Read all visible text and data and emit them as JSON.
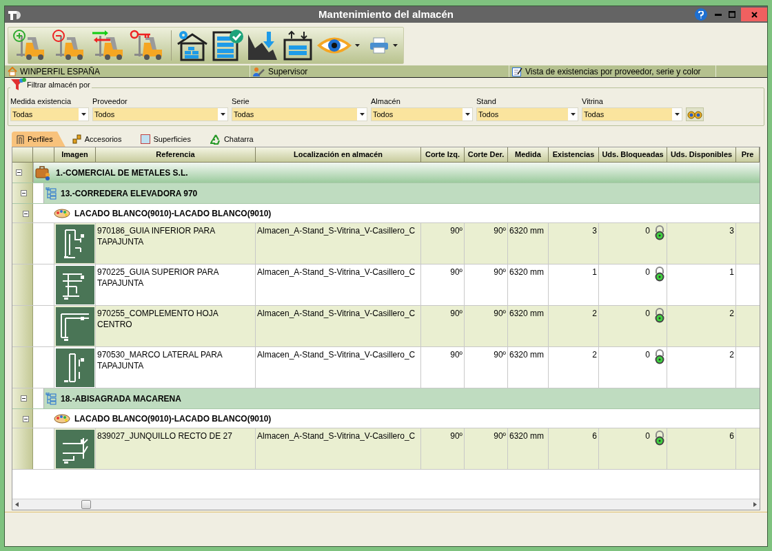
{
  "window": {
    "title": "Mantenimiento del almacén"
  },
  "status_bar": [
    "WINPERFIL ESPAÑA",
    "Supervisor",
    "Vista de existencias por proveedor, serie y color"
  ],
  "filter": {
    "title": "Filtrar almacén por",
    "fields": [
      {
        "label": "Medida existencia",
        "value": "Todas"
      },
      {
        "label": "Proveedor",
        "value": "Todos"
      },
      {
        "label": "Serie",
        "value": "Todas"
      },
      {
        "label": "Almacén",
        "value": "Todos"
      },
      {
        "label": "Stand",
        "value": "Todos"
      },
      {
        "label": "Vitrina",
        "value": "Todas"
      }
    ]
  },
  "tabs": [
    {
      "label": "Perfiles",
      "selected": true
    },
    {
      "label": "Accesorios",
      "selected": false
    },
    {
      "label": "Superficies",
      "selected": false
    },
    {
      "label": "Chatarra",
      "selected": false
    }
  ],
  "table": {
    "columns": [
      "Imagen",
      "Referencia",
      "Localización en almacén",
      "Corte Izq.",
      "Corte Der.",
      "Medida",
      "Existencias",
      "Uds. Bloqueadas",
      "Uds. Disponibles",
      "Pre"
    ],
    "suppliers": [
      {
        "name": "1.-COMERCIAL DE METALES S.L.",
        "expanded": true,
        "series": [
          {
            "name": "13.-CORREDERA ELEVADORA 970",
            "expanded": true,
            "colors": [
              {
                "name": "LACADO BLANCO(9010)-LACADO BLANCO(9010)",
                "expanded": true,
                "rows": [
                  {
                    "reference": "970186_GUIA INFERIOR PARA TAPAJUNTA",
                    "location": "Almacen_A-Stand_S-Vitrina_V-Casillero_C",
                    "corte_izq": "90º",
                    "corte_der": "90º",
                    "medida": "6320 mm",
                    "existencias": "3",
                    "bloqueadas": "0",
                    "disponibles": "3"
                  },
                  {
                    "reference": "970225_GUIA SUPERIOR PARA TAPAJUNTA",
                    "location": "Almacen_A-Stand_S-Vitrina_V-Casillero_C",
                    "corte_izq": "90º",
                    "corte_der": "90º",
                    "medida": "6320 mm",
                    "existencias": "1",
                    "bloqueadas": "0",
                    "disponibles": "1"
                  },
                  {
                    "reference": "970255_COMPLEMENTO HOJA CENTRO",
                    "location": "Almacen_A-Stand_S-Vitrina_V-Casillero_C",
                    "corte_izq": "90º",
                    "corte_der": "90º",
                    "medida": "6320 mm",
                    "existencias": "2",
                    "bloqueadas": "0",
                    "disponibles": "2"
                  },
                  {
                    "reference": "970530_MARCO LATERAL PARA TAPAJUNTA",
                    "location": "Almacen_A-Stand_S-Vitrina_V-Casillero_C",
                    "corte_izq": "90º",
                    "corte_der": "90º",
                    "medida": "6320 mm",
                    "existencias": "2",
                    "bloqueadas": "0",
                    "disponibles": "2"
                  }
                ]
              }
            ]
          },
          {
            "name": "18.-ABISAGRADA MACARENA",
            "expanded": true,
            "colors": [
              {
                "name": "LACADO BLANCO(9010)-LACADO BLANCO(9010)",
                "expanded": true,
                "rows": [
                  {
                    "reference": "839027_JUNQUILLO RECTO DE 27",
                    "location": "Almacen_A-Stand_S-Vitrina_V-Casillero_C",
                    "corte_izq": "90º",
                    "corte_der": "90º",
                    "medida": "6320 mm",
                    "existencias": "6",
                    "bloqueadas": "0",
                    "disponibles": "6"
                  }
                ]
              }
            ]
          }
        ]
      }
    ]
  }
}
